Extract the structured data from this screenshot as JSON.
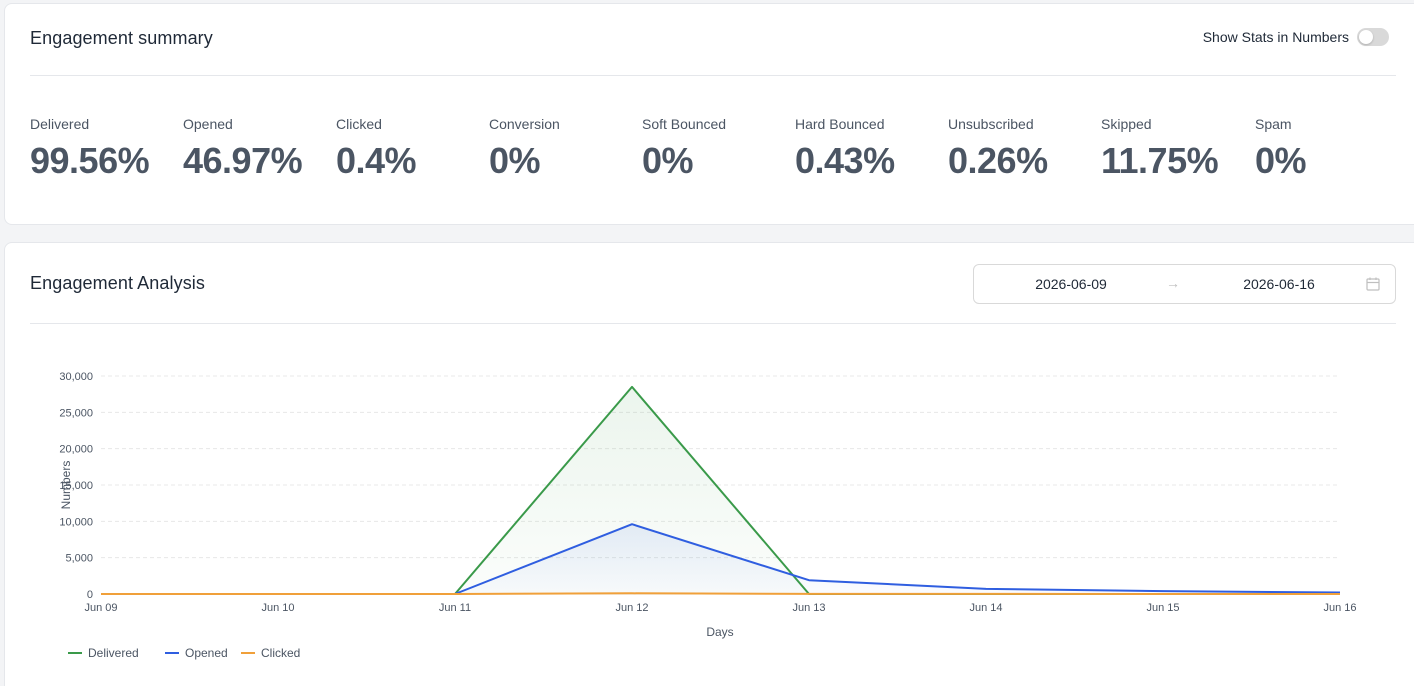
{
  "summary": {
    "title": "Engagement summary",
    "toggle_label": "Show Stats in Numbers",
    "toggle_on": false,
    "stats": [
      {
        "label": "Delivered",
        "value": "99.56%"
      },
      {
        "label": "Opened",
        "value": "46.97%"
      },
      {
        "label": "Clicked",
        "value": "0.4%"
      },
      {
        "label": "Conversion",
        "value": "0%"
      },
      {
        "label": "Soft Bounced",
        "value": "0%"
      },
      {
        "label": "Hard Bounced",
        "value": "0.43%"
      },
      {
        "label": "Unsubscribed",
        "value": "0.26%"
      },
      {
        "label": "Skipped",
        "value": "11.75%"
      },
      {
        "label": "Spam",
        "value": "0%"
      }
    ]
  },
  "analysis": {
    "title": "Engagement Analysis",
    "date_start": "2026-06-09",
    "date_end": "2026-06-16",
    "arrow_icon": "arrow-right-icon",
    "calendar_icon": "calendar-icon"
  },
  "chart_data": {
    "type": "line",
    "xlabel": "Days",
    "ylabel": "Numbers",
    "categories": [
      "Jun 09",
      "Jun 10",
      "Jun 11",
      "Jun 12",
      "Jun 13",
      "Jun 14",
      "Jun 15",
      "Jun 16"
    ],
    "y_ticks": [
      "0",
      "5,000",
      "10,000",
      "15,000",
      "20,000",
      "25,000",
      "30,000"
    ],
    "ylim": [
      0,
      30000
    ],
    "grid": true,
    "legend_position": "bottom-left",
    "series": [
      {
        "name": "Delivered",
        "color": "#3a9a4a",
        "values": [
          0,
          0,
          0,
          28500,
          0,
          0,
          0,
          0
        ]
      },
      {
        "name": "Opened",
        "color": "#2f5ee0",
        "values": [
          0,
          0,
          0,
          9600,
          1900,
          700,
          400,
          200
        ]
      },
      {
        "name": "Clicked",
        "color": "#f0a03a",
        "values": [
          0,
          0,
          0,
          100,
          20,
          10,
          5,
          0
        ]
      }
    ]
  }
}
